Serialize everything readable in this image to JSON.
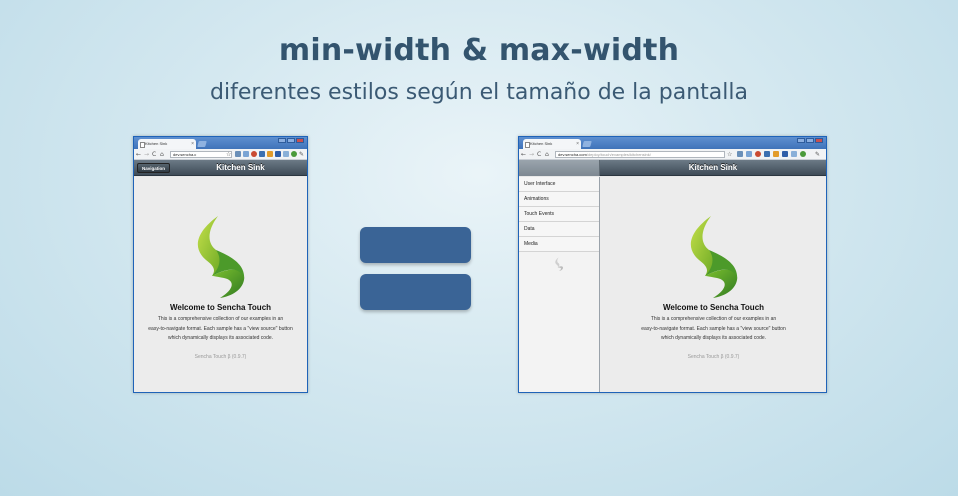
{
  "header": {
    "title": "min-width & max-width",
    "subtitle": "diferentes estilos según el tamaño de la pantalla"
  },
  "colors": {
    "title": "#33546e",
    "accent_equals": "#3a6496",
    "window_frame": "#1f63b8",
    "app_toolbar": "#4b5864"
  },
  "browser_small": {
    "tab_label": "Kitchen Sink",
    "url": "dev.sencha.c",
    "app_title": "Kitchen Sink",
    "nav_button": "Navigation"
  },
  "browser_large": {
    "tab_label": "Kitchen Sink",
    "url_host": "dev.sencha.com",
    "url_path": "/deploy/touch/examples/kitchensink/",
    "app_title": "Kitchen Sink",
    "menu": [
      "User Interface",
      "Animations",
      "Touch Events",
      "Data",
      "Media"
    ]
  },
  "welcome": {
    "heading": "Welcome to Sencha Touch",
    "line1": "This is a comprehensive collection of our examples in an",
    "line2": "easy-to-navigate format. Each sample has a \"view source\" button",
    "line3": "which dynamically displays its associated code.",
    "version": "Sencha Touch β (0.9.7)"
  },
  "icons": [
    "sencha-logo-icon",
    "back-icon",
    "forward-icon",
    "reload-icon",
    "home-icon",
    "star-icon",
    "wrench-icon"
  ]
}
